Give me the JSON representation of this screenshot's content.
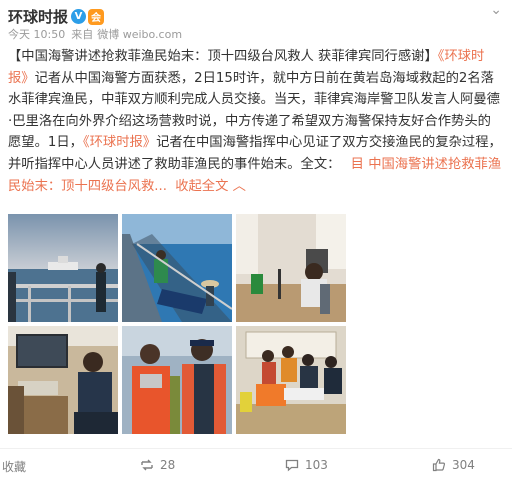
{
  "post": {
    "author": "环球时报",
    "verified_badge": "V",
    "member_badge": "会",
    "time": "今天 10:50",
    "source_prefix": "来自",
    "source": "微博 weibo.com",
    "text_pre_title": "【",
    "title": "中国海警讲述抢救菲渔民始末：顶十四级台风救人 获菲律宾同行感谢",
    "text_post_title": "】",
    "link_name": "《环球时报》",
    "body_part1": "记者从中国海警方面获悉，2日15时许，就中方日前在黄岩岛海域救起的2名落水菲律宾渔民，中菲双方顺利完成人员交接。当天，菲律宾海岸警卫队发言人阿曼德·巴里洛在向外界介绍这场营救时说，中方传递了希望双方海警保持友好合作势头的愿望。1日，",
    "link_name2": "《环球时报》",
    "body_part2": "记者在中国海警指挥中心见证了双方交接渔民的复杂过程，并听指挥中心人员讲述了救助菲渔民的事件始末。全文：",
    "article_icon": "目",
    "article_link": "中国海警讲述抢救菲渔民始末：顶十四级台风救...",
    "collapse": "收起全文",
    "collapse_icon": "︿"
  },
  "footer": {
    "favorite": "收藏",
    "reposts": "28",
    "comments": "103",
    "likes": "304"
  },
  "colors": {
    "link": "#eb7350",
    "meta": "#9b9b9b",
    "verified": "#2c9ee8",
    "member": "#ff9a1f"
  },
  "photos": [
    "sea-patrol-ship-photo",
    "ship-deck-sea-photo",
    "radio-room-photo",
    "cabin-interview-photo",
    "coast-guard-officers-photo",
    "handover-meeting-photo"
  ]
}
